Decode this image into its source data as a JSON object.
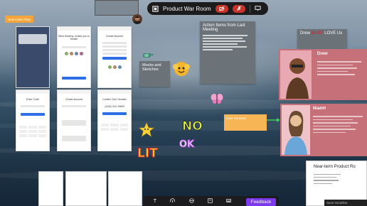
{
  "toolbar": {
    "title": "Product War Room",
    "mic_icon": "mic-off-icon",
    "camera_icon": "camera-off-icon",
    "screen_icon": "screen-icon",
    "logo_icon": "room-logo-icon"
  },
  "labels": {
    "new_invite_flow": "New Invite Flow",
    "mocks_and_sketches": "Mocks and Sketches",
    "action_items_title": "Action Items from Last Meeting",
    "drew_note_pre": "Drew ",
    "drew_note_must": "MUST",
    "drew_note_post": " LOVE Us",
    "persona_drew": "Drew",
    "persona_niamh": "Niamh",
    "user_persona": "User Persona",
    "near_term_title": "Near-term Product Ro",
    "save_text": "Save in/outline"
  },
  "phone_screens": {
    "s2_title": "Meet Sketchy, Invited you to Mobile",
    "s3_title": "Create Account",
    "s4_title": "Enter Code",
    "s5_title": "Create Account",
    "s6_title": "Confirm Your Number",
    "s6_number": "(415) 312-0983"
  },
  "stickers": {
    "no": "NO",
    "ok": "OK",
    "lit": "LIT"
  },
  "bottom_bar": {
    "text_tool": "T",
    "feedback": "Feedback"
  },
  "colors": {
    "accent_purple": "#7c3aed",
    "toggle_red": "#c9342a",
    "sticky_orange": "#f4a53a",
    "persona_pink": "#c6707a",
    "must_red": "#e0182e"
  }
}
